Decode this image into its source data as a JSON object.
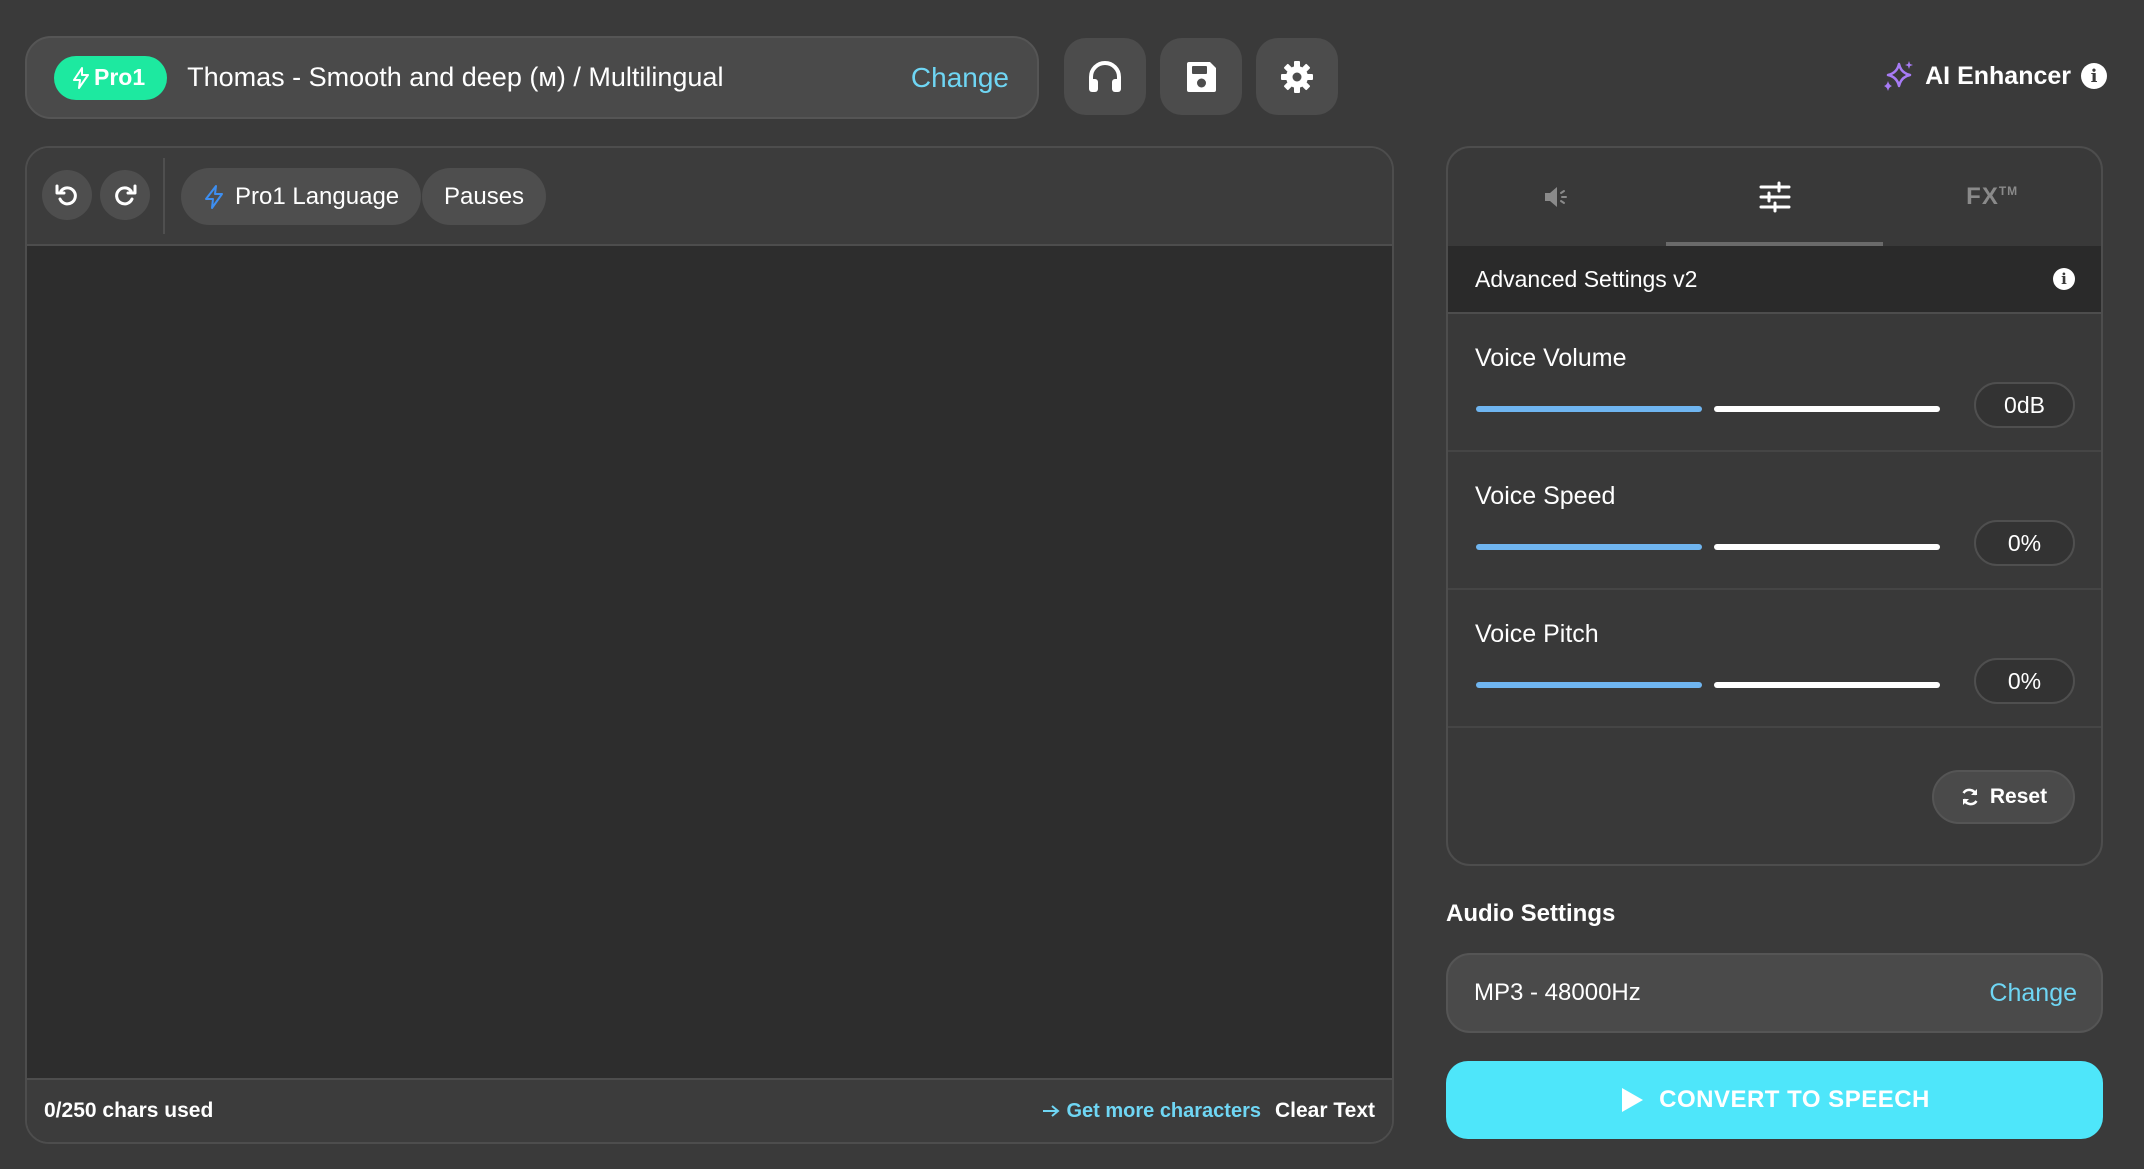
{
  "voice_bar": {
    "badge": "Pro1",
    "voice": "Thomas - Smooth and deep (ᴍ) / Multilingual",
    "change": "Change"
  },
  "top_icons": [
    "headphones-icon",
    "save-icon",
    "settings-icon"
  ],
  "ai_enhancer": {
    "label": "AI Enhancer",
    "info": "i"
  },
  "editor": {
    "language_label": "Pro1 Language",
    "pauses_label": "Pauses",
    "text": "",
    "chars_used": "0/250 chars used",
    "get_more": "Get more characters",
    "clear_text": "Clear Text"
  },
  "settings": {
    "tabs": [
      {
        "icon": "speaker-icon",
        "label": ""
      },
      {
        "icon": "sliders-icon",
        "label": ""
      },
      {
        "icon": "",
        "label": "FX",
        "mark": "TM"
      }
    ],
    "header": "Advanced Settings v2",
    "sliders": [
      {
        "label": "Voice Volume",
        "value": "0dB",
        "level": 0.5
      },
      {
        "label": "Voice Speed",
        "value": "0%",
        "level": 0.5
      },
      {
        "label": "Voice Pitch",
        "value": "0%",
        "level": 0.5
      }
    ],
    "reset": "Reset"
  },
  "audio": {
    "title": "Audio Settings",
    "value": "MP3 - 48000Hz",
    "change": "Change"
  },
  "convert": {
    "label": "CONVERT TO SPEECH"
  },
  "colors": {
    "accent_green": "#1de9a0",
    "accent_cyan": "#4ee6fa",
    "link": "#6fd6f4",
    "slider_fill": "#6fb5f0",
    "background": "#3a3a3a"
  }
}
